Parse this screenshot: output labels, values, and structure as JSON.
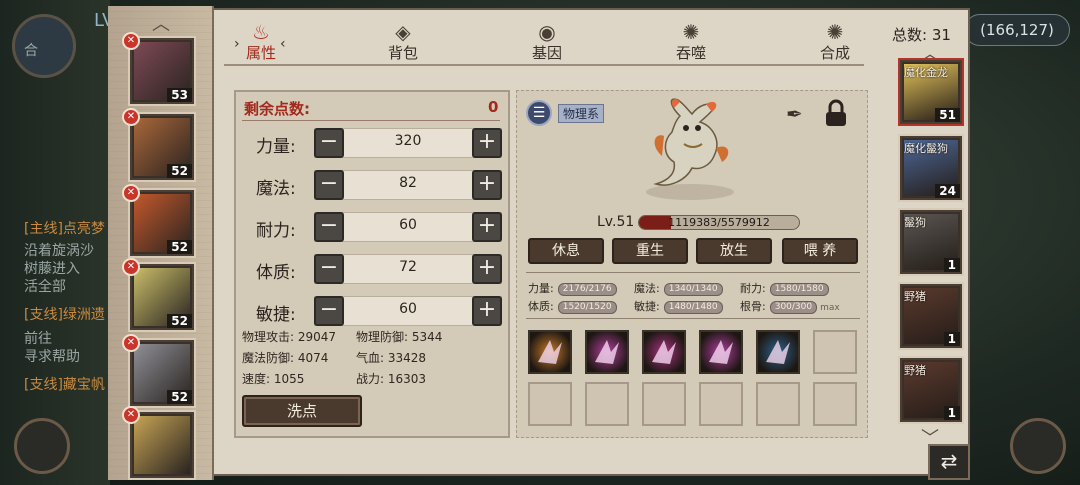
{
  "background": {
    "hero_level": "LV",
    "coords": "(166,127)",
    "quest_lines": [
      "合",
      "[主线]点亮梦",
      "沿着旋涡沙",
      "树藤进入",
      "活全部",
      "[支线]绿洲遗",
      "前往",
      "寻求帮助",
      "[支线]藏宝帆"
    ]
  },
  "tabs": [
    {
      "label": "属性",
      "icon": "flame-icon"
    },
    {
      "label": "背包",
      "icon": "bag-icon"
    },
    {
      "label": "基因",
      "icon": "eye-icon"
    },
    {
      "label": "吞噬",
      "icon": "swirl-icon"
    },
    {
      "label": "合成",
      "icon": "swirl-icon"
    }
  ],
  "stats": {
    "remaining_label": "剩余点数:",
    "remaining_value": "0",
    "rows": [
      {
        "name": "力量:",
        "value": "320"
      },
      {
        "name": "魔法:",
        "value": "82"
      },
      {
        "name": "耐力:",
        "value": "60"
      },
      {
        "name": "体质:",
        "value": "72"
      },
      {
        "name": "敏捷:",
        "value": "60"
      }
    ],
    "derived": [
      {
        "label": "物理攻击: 29047"
      },
      {
        "label": "物理防御: 5344"
      },
      {
        "label": "魔法防御: 4074"
      },
      {
        "label": "气血: 33428"
      },
      {
        "label": "速度: 1055"
      },
      {
        "label": "战力: 16303"
      }
    ],
    "reset_label": "洗点"
  },
  "detail": {
    "type_tag": "物理系",
    "level": "Lv.51",
    "hp_text": "1119383/5579912",
    "hp_ratio": 0.2,
    "actions": [
      "休息",
      "重生",
      "放生",
      "喂 养"
    ],
    "attrs": [
      {
        "label": "力量:",
        "value": "2176/2176"
      },
      {
        "label": "魔法:",
        "value": "1340/1340"
      },
      {
        "label": "耐力:",
        "value": "1580/1580"
      },
      {
        "label": "体质:",
        "value": "1520/1520"
      },
      {
        "label": "敏捷:",
        "value": "1480/1480"
      },
      {
        "label": "根骨:",
        "value": "300/300",
        "suffix": "max"
      }
    ],
    "skills": [
      {
        "color": "#c77a2a"
      },
      {
        "color": "#b23f9d"
      },
      {
        "color": "#a8337f"
      },
      {
        "color": "#b03ea0"
      },
      {
        "color": "#2e5f88"
      }
    ]
  },
  "left_pets": [
    {
      "level": "53",
      "color": "#7e4a55"
    },
    {
      "level": "52",
      "color": "#a9673a"
    },
    {
      "level": "52",
      "color": "#c3582c"
    },
    {
      "level": "52",
      "color": "#c9bd6a"
    },
    {
      "level": "52",
      "color": "#8f8f96"
    },
    {
      "level": "",
      "color": "#c7a455"
    }
  ],
  "right_list": {
    "count_label": "总数: 31",
    "pets": [
      {
        "name": "魔化金龙",
        "level": "51",
        "color": "#e3c25a"
      },
      {
        "name": "魔化鬣狗",
        "level": "24",
        "color": "#4d6796"
      },
      {
        "name": "鬣狗",
        "level": "1",
        "color": "#5a5652"
      },
      {
        "name": "野猪",
        "level": "1",
        "color": "#5b3a2e"
      },
      {
        "name": "野猪",
        "level": "1",
        "color": "#5b3a2e"
      }
    ]
  }
}
